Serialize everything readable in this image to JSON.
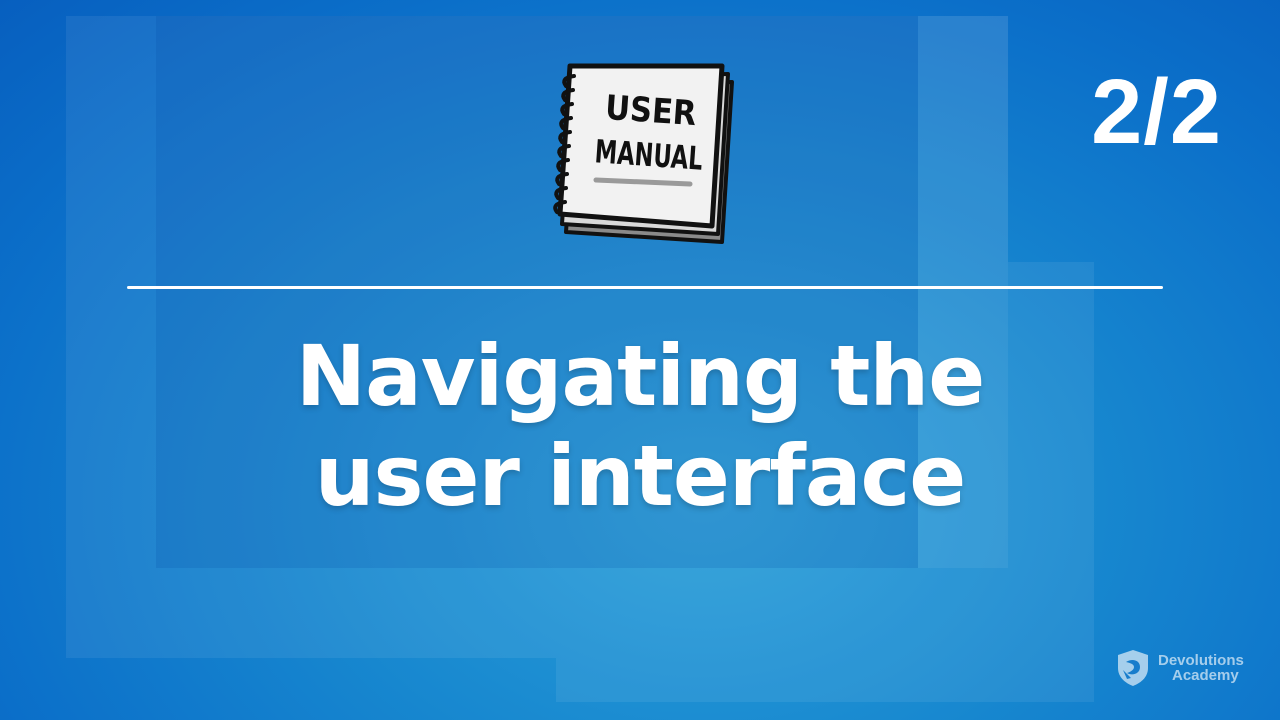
{
  "slide": {
    "counter": "2/2",
    "title_line1": "Navigating the",
    "title_line2": "user interface"
  },
  "illustration": {
    "icon": "user-manual-book-icon",
    "line1": "USER",
    "line2": "MANUAL"
  },
  "brand": {
    "icon": "devolutions-shield-icon",
    "line1": "Devolutions",
    "line2": "Academy"
  },
  "colors": {
    "background": "#0b6fc9",
    "text": "#ffffff"
  }
}
